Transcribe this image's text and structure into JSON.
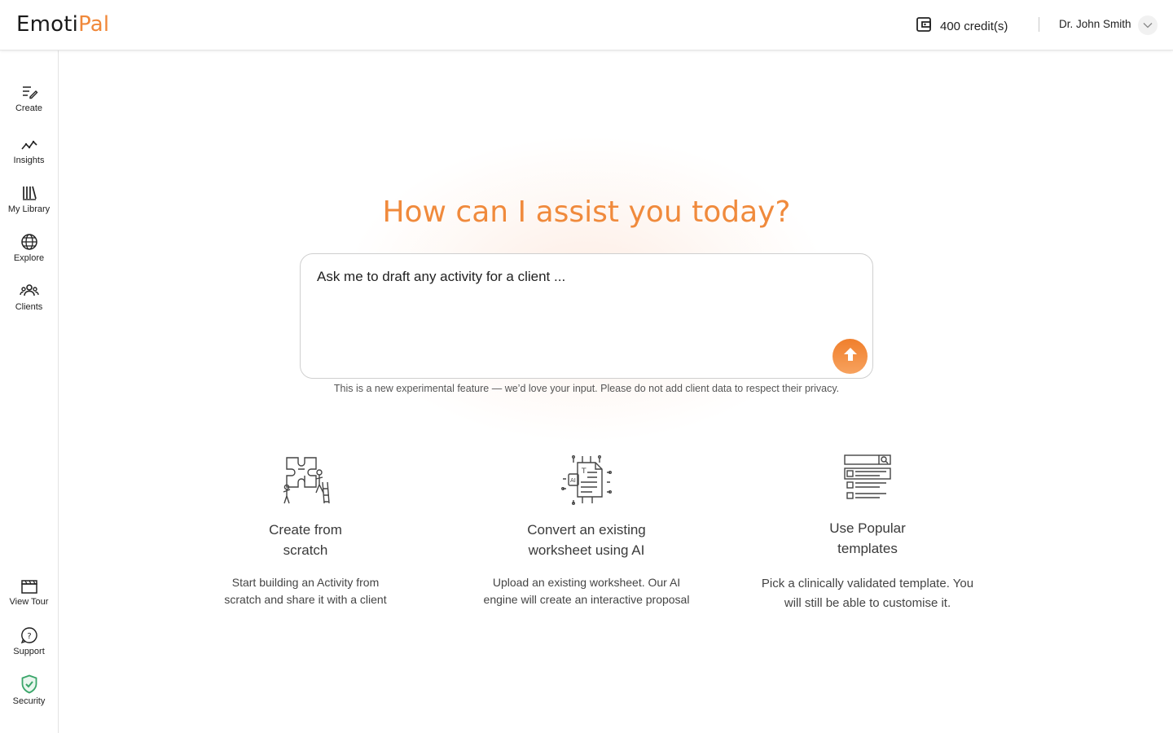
{
  "brand": {
    "part1": "Emoti",
    "part2": "Pal"
  },
  "header": {
    "credits": "400 credit(s)",
    "user_name": "Dr. John Smith"
  },
  "sidebar": {
    "items": [
      {
        "label": "Create",
        "icon": "create-icon"
      },
      {
        "label": "Insights",
        "icon": "insights-icon"
      },
      {
        "label": "My Library",
        "icon": "library-icon"
      },
      {
        "label": "Explore",
        "icon": "globe-icon"
      },
      {
        "label": "Clients",
        "icon": "clients-icon"
      }
    ],
    "bottom_items": [
      {
        "label": "View Tour",
        "icon": "clapperboard-icon"
      },
      {
        "label": "Support",
        "icon": "help-icon"
      },
      {
        "label": "Security",
        "icon": "shield-check-icon"
      }
    ]
  },
  "main": {
    "headline": "How can I assist you today?",
    "prompt_placeholder": "Ask me to draft any activity for a client ...",
    "disclaimer": "This is a new experimental feature — we’d love your input. Please do not add client data to respect their privacy.",
    "cards": [
      {
        "title_line1": "Create from",
        "title_line2": "scratch",
        "desc_line1": "Start building an Activity from",
        "desc_line2": "scratch and share it with a client",
        "icon": "puzzle-icon"
      },
      {
        "title_line1": "Convert an existing",
        "title_line2": "worksheet using AI",
        "desc_line1": "Upload an existing worksheet. Our AI",
        "desc_line2": "engine will create an interactive proposal",
        "icon": "ai-document-icon"
      },
      {
        "title_line1": "Use Popular",
        "title_line2": "templates",
        "desc_line1": "Pick a clinically validated template. You",
        "desc_line2": "will still be able to customise it.",
        "icon": "template-list-icon"
      }
    ]
  },
  "colors": {
    "accent": "#f08a3c",
    "security": "#3aa66a"
  }
}
